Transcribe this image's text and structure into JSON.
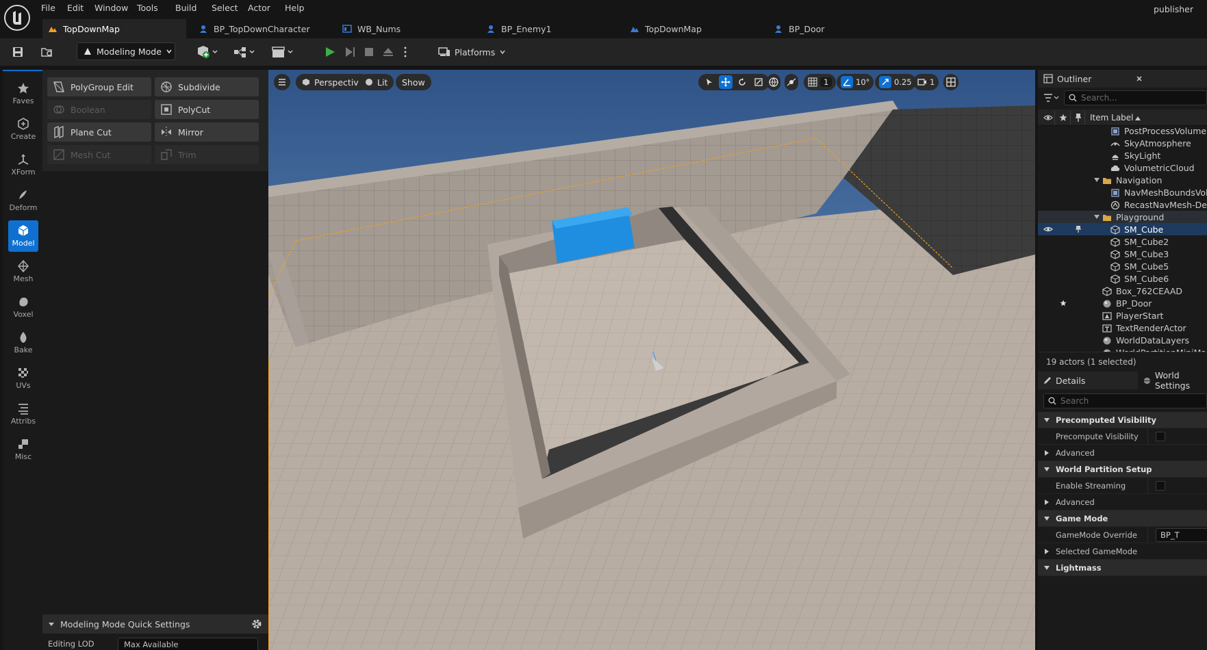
{
  "menu": {
    "items": [
      "File",
      "Edit",
      "Window",
      "Tools",
      "Build",
      "Select",
      "Actor",
      "Help"
    ],
    "user": "publisher"
  },
  "tabs": [
    {
      "label": "TopDownMap",
      "icon": "level-icon",
      "active": true
    },
    {
      "label": "BP_TopDownCharacter",
      "icon": "blueprint-icon",
      "active": false
    },
    {
      "label": "WB_Nums",
      "icon": "widget-blueprint-icon",
      "active": false
    },
    {
      "label": "BP_Enemy1",
      "icon": "blueprint-icon",
      "active": false
    },
    {
      "label": "TopDownMap",
      "icon": "level-icon",
      "active": false
    },
    {
      "label": "BP_Door",
      "icon": "blueprint-icon",
      "active": false
    }
  ],
  "toolbar": {
    "mode": "Modeling Mode",
    "platforms": "Platforms"
  },
  "mode_bar": [
    {
      "label": "Faves",
      "icon": "star-icon"
    },
    {
      "label": "Create",
      "icon": "create-icon"
    },
    {
      "label": "XForm",
      "icon": "xform-icon"
    },
    {
      "label": "Deform",
      "icon": "deform-icon"
    },
    {
      "label": "Model",
      "icon": "model-icon",
      "active": true
    },
    {
      "label": "Mesh",
      "icon": "mesh-icon"
    },
    {
      "label": "Voxel",
      "icon": "voxel-icon"
    },
    {
      "label": "Bake",
      "icon": "bake-icon"
    },
    {
      "label": "UVs",
      "icon": "uvs-icon"
    },
    {
      "label": "Attribs",
      "icon": "attribs-icon"
    },
    {
      "label": "Misc",
      "icon": "misc-icon"
    }
  ],
  "tools": [
    {
      "label": "PolyGroup Edit",
      "enabled": true
    },
    {
      "label": "Subdivide",
      "enabled": true
    },
    {
      "label": "Boolean",
      "enabled": false
    },
    {
      "label": "PolyCut",
      "enabled": true
    },
    {
      "label": "Plane Cut",
      "enabled": true
    },
    {
      "label": "Mirror",
      "enabled": true
    },
    {
      "label": "Mesh Cut",
      "enabled": false
    },
    {
      "label": "Trim",
      "enabled": false
    }
  ],
  "quick_settings": {
    "title": "Modeling Mode Quick Settings",
    "editing_lod_label": "Editing LOD",
    "editing_lod_value": "Max Available"
  },
  "viewport": {
    "menu": "≡",
    "perspective": "Perspective",
    "lit": "Lit",
    "show": "Show",
    "grid_snap": "1",
    "rotation_snap": "10°",
    "scale_snap": "0.25",
    "camera_speed": "1"
  },
  "outliner": {
    "title": "Outliner",
    "search_placeholder": "Search...",
    "column_label": "Item Label",
    "items": [
      {
        "label": "PostProcessVolume",
        "icon": "volume-icon",
        "indent": 2
      },
      {
        "label": "SkyAtmosphere",
        "icon": "sky-atmosphere-icon",
        "indent": 2
      },
      {
        "label": "SkyLight",
        "icon": "skylight-icon",
        "indent": 2
      },
      {
        "label": "VolumetricCloud",
        "icon": "cloud-icon",
        "indent": 2
      },
      {
        "label": "Navigation",
        "icon": "folder-icon",
        "indent": 1,
        "folder": true
      },
      {
        "label": "NavMeshBoundsVolume",
        "icon": "volume-icon",
        "indent": 2
      },
      {
        "label": "RecastNavMesh-Default",
        "icon": "navmesh-icon",
        "indent": 2
      },
      {
        "label": "Playground",
        "icon": "folder-icon",
        "indent": 1,
        "folder": true,
        "highlight": true
      },
      {
        "label": "SM_Cube",
        "icon": "static-mesh-icon",
        "indent": 2,
        "selected": true
      },
      {
        "label": "SM_Cube2",
        "icon": "static-mesh-icon",
        "indent": 2
      },
      {
        "label": "SM_Cube3",
        "icon": "static-mesh-icon",
        "indent": 2
      },
      {
        "label": "SM_Cube5",
        "icon": "static-mesh-icon",
        "indent": 2
      },
      {
        "label": "SM_Cube6",
        "icon": "static-mesh-icon",
        "indent": 2
      },
      {
        "label": "Box_762CEAAD",
        "icon": "static-mesh-icon",
        "indent": 1
      },
      {
        "label": "BP_Door",
        "icon": "actor-icon",
        "indent": 1,
        "starred": true
      },
      {
        "label": "PlayerStart",
        "icon": "player-start-icon",
        "indent": 1
      },
      {
        "label": "TextRenderActor",
        "icon": "text-render-icon",
        "indent": 1
      },
      {
        "label": "WorldDataLayers",
        "icon": "actor-icon",
        "indent": 1
      },
      {
        "label": "WorldPartitionMiniMap",
        "icon": "actor-icon",
        "indent": 1
      }
    ],
    "status": "19 actors (1 selected)"
  },
  "details": {
    "tab": "Details",
    "tab2": "World Settings",
    "search_placeholder": "Search",
    "rows": [
      {
        "label": "Precomputed Visibility",
        "type": "section"
      },
      {
        "label": "Precompute Visibility",
        "type": "checkbox"
      },
      {
        "label": "Advanced",
        "type": "collapsed"
      },
      {
        "label": "World Partition Setup",
        "type": "section"
      },
      {
        "label": "Enable Streaming",
        "type": "checkbox"
      },
      {
        "label": "Advanced",
        "type": "collapsed"
      },
      {
        "label": "Game Mode",
        "type": "section"
      },
      {
        "label": "GameMode Override",
        "type": "value",
        "value": "BP_T"
      },
      {
        "label": "Selected GameMode",
        "type": "collapsed"
      },
      {
        "label": "Lightmass",
        "type": "section"
      }
    ]
  },
  "colors": {
    "accent": "#0f70d0",
    "selection": "#1e3a5e",
    "cube": "#1f8ee0",
    "sky": "#3a5c8c",
    "floor": "#b8ada3"
  }
}
